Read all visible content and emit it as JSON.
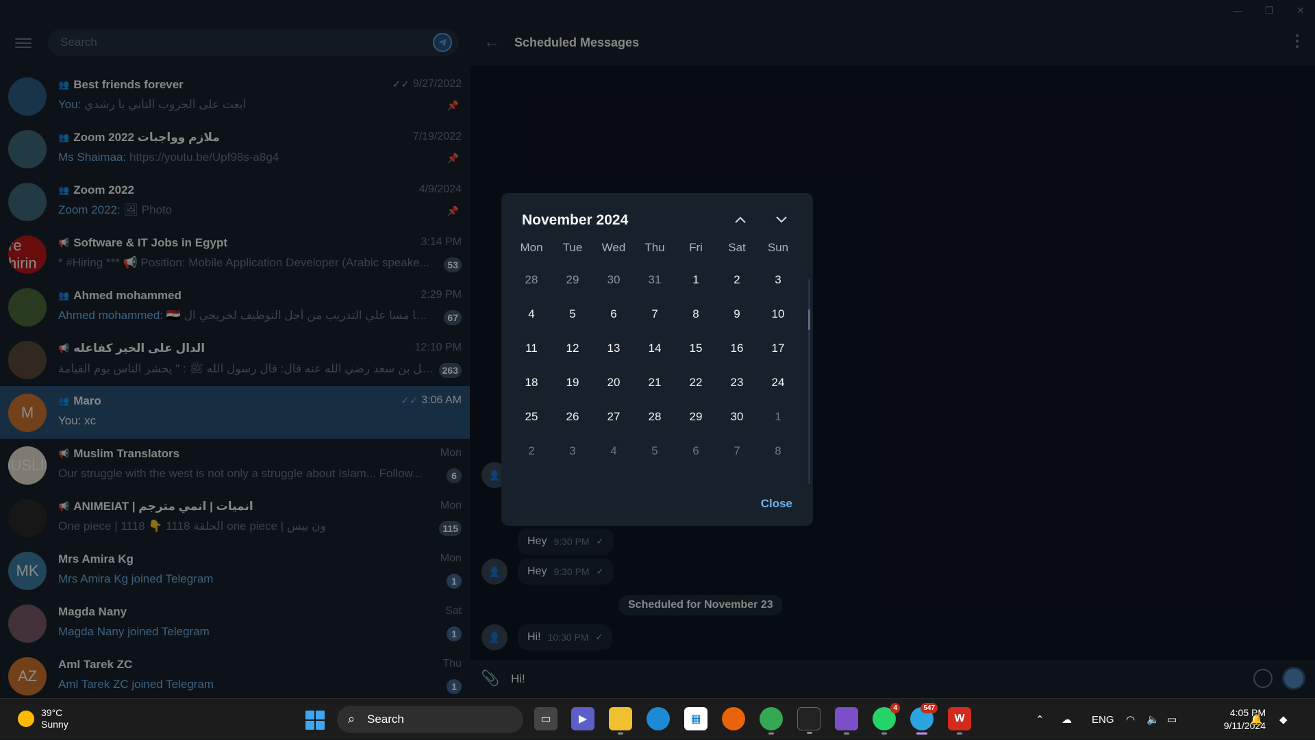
{
  "left": {
    "search_placeholder": "Search",
    "chats": [
      {
        "title": "Best friends forever",
        "type": "group",
        "time": "9/27/2022",
        "read": true,
        "sender": "You:",
        "text": "ابعت على الجروب التاني يا رشدي",
        "pinned": true,
        "avatar_color": "#2e5f86",
        "avatar_text": ""
      },
      {
        "title": "Zoom 2022 ملازم وواجبات",
        "type": "group",
        "time": "7/19/2022",
        "sender": "Ms Shaimaa:",
        "text": "https://youtu.be/Upf98s-a8g4",
        "pinned": true,
        "avatar_color": "#3c6a7a",
        "avatar_text": ""
      },
      {
        "title": "Zoom 2022",
        "type": "group",
        "time": "4/9/2024",
        "sender": "Zoom 2022:",
        "text": "🖼 Photo",
        "pinned": true,
        "avatar_color": "#3c6a7a",
        "avatar_text": ""
      },
      {
        "title": "Software & IT Jobs in Egypt",
        "type": "channel",
        "time": "3:14 PM",
        "sender": "",
        "text": "* #Hiring *** 📢 Position: Mobile Application Developer (Arabic speake...",
        "badge": "53",
        "avatar_color": "#c0161b",
        "avatar_text": "re hirin"
      },
      {
        "title": "Ahmed mohammed",
        "type": "group",
        "time": "2:29 PM",
        "sender": "Ahmed mohammed:",
        "text": "🇪🇬 مسا مسا علي التدريب من أجل التوظيف لخريجي ال... ✨",
        "badge": "67",
        "avatar_color": "#4a6a3a",
        "avatar_text": ""
      },
      {
        "title": "الدال على الخير كفاعله",
        "type": "channel",
        "time": "12:10 PM",
        "sender": "",
        "text": "عن سهل بن سعد رضي الله عنه قال: قال رسول الله ﷺ : \" يحشر الناس يوم القيامة ...",
        "badge": "263",
        "avatar_color": "#5a4a3a",
        "avatar_text": ""
      },
      {
        "title": "Maro",
        "type": "group",
        "time": "3:06 AM",
        "read": true,
        "sender": "",
        "text": "You: xc",
        "active": true,
        "avatar_color": "#d0762e",
        "avatar_text": "M"
      },
      {
        "title": "Muslim Translators",
        "type": "channel",
        "time": "Mon",
        "sender": "",
        "text": "Our struggle with the west is not only a struggle about Islam... Follow...",
        "badge": "6",
        "avatar_color": "#e8e0d0",
        "avatar_text": "MUSLIM"
      },
      {
        "title": "ANIMEIAT | انميات | انمي مترجم",
        "type": "channel",
        "time": "Mon",
        "sender": "",
        "text": "One piece | 1118 👇 1118 الحلقة one piece | ون بيس",
        "badge": "115",
        "avatar_color": "#2a2a2a",
        "avatar_text": ""
      },
      {
        "title": "Mrs Amira Kg",
        "type": "user",
        "time": "Mon",
        "sender": "",
        "text": "Mrs Amira Kg joined Telegram",
        "link": true,
        "badge": "1",
        "avatar_color": "#3d7ea6",
        "avatar_text": "MK"
      },
      {
        "title": "Magda Nany",
        "type": "user",
        "time": "Sat",
        "sender": "",
        "text": "Magda Nany joined Telegram",
        "link": true,
        "badge": "1",
        "avatar_color": "#7a5a6a",
        "avatar_text": ""
      },
      {
        "title": "Aml Tarek ZC",
        "type": "user",
        "time": "Thu",
        "sender": "",
        "text": "Aml Tarek ZC joined Telegram",
        "link": true,
        "badge": "1",
        "avatar_color": "#d0762e",
        "avatar_text": "AZ"
      }
    ]
  },
  "right": {
    "title": "Scheduled Messages",
    "messages": [
      {
        "text": "Hey",
        "time": "9:30 PM"
      },
      {
        "text": "Hey",
        "time": "9:30 PM"
      }
    ],
    "date_pill": "Scheduled for November 23",
    "last_message": {
      "text": "Hi!",
      "time": "10:30 PM"
    },
    "composer_value": "Hi!"
  },
  "calendar": {
    "title": "November 2024",
    "weekdays": [
      "Mon",
      "Tue",
      "Wed",
      "Thu",
      "Fri",
      "Sat",
      "Sun"
    ],
    "days": [
      "28",
      "29",
      "30",
      "31",
      "1",
      "2",
      "3",
      "4",
      "5",
      "6",
      "7",
      "8",
      "9",
      "10",
      "11",
      "12",
      "13",
      "14",
      "15",
      "16",
      "17",
      "18",
      "19",
      "20",
      "21",
      "22",
      "23",
      "24",
      "25",
      "26",
      "27",
      "28",
      "29",
      "30",
      "1",
      "2",
      "3",
      "4",
      "5",
      "6",
      "7",
      "8"
    ],
    "close_label": "Close"
  },
  "taskbar": {
    "temperature": "39°C",
    "condition": "Sunny",
    "search_placeholder": "Search",
    "whatsapp_badge": "4",
    "telegram_badge": "547",
    "language": "ENG",
    "time": "4:05 PM",
    "date": "9/11/2024"
  }
}
